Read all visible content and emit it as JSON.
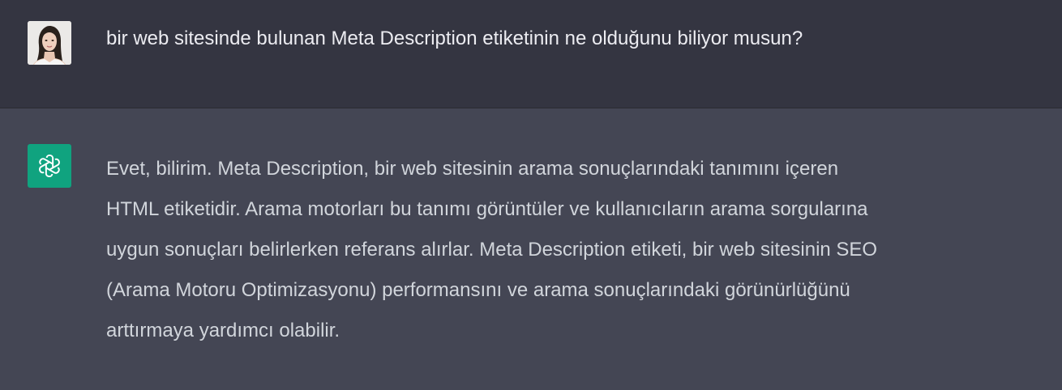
{
  "conversation": {
    "user_message": {
      "avatar_icon": "user-avatar-photo",
      "text": "bir web sitesinde bulunan Meta Description etiketinin ne olduğunu biliyor musun?"
    },
    "assistant_message": {
      "avatar_icon": "openai-logo-icon",
      "accent_color": "#10a37f",
      "lines": [
        "Evet, bilirim. Meta Description, bir web sitesinin arama sonuçlarındaki tanımını içeren",
        "HTML etiketidir. Arama motorları bu tanımı görüntüler ve kullanıcıların arama sorgularına",
        "uygun sonuçları belirlerken referans alırlar. Meta Description etiketi, bir web sitesinin SEO",
        "(Arama Motoru Optimizasyonu) performansını ve arama sonuçlarındaki görünürlüğünü",
        "arttırmaya yardımcı olabilir."
      ]
    }
  }
}
